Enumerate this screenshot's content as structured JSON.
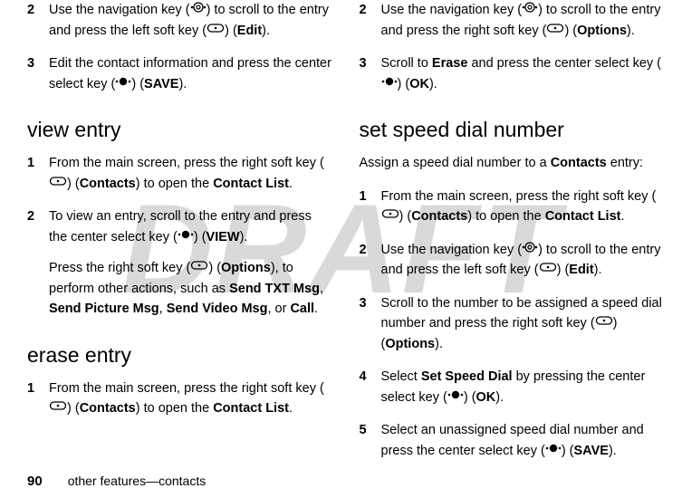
{
  "watermark": "DRAFT",
  "left": {
    "steps_a": [
      {
        "num": "2",
        "body": "Use the navigation key (NAV) to scroll to the entry and press the left soft key (LSOFT) (<b>Edit</b>)."
      },
      {
        "num": "3",
        "body": "Edit the contact information and press the center select key (CENTER) (<b>SAVE</b>)."
      }
    ],
    "section_view": "view entry",
    "steps_view": [
      {
        "num": "1",
        "body": "From the main screen, press the right soft key (RSOFT) (<b>Contacts</b>) to open the <b>Contact List</b>."
      },
      {
        "num": "2",
        "body": "To view an entry, scroll to the entry and press the center select key (CENTER) (<b>VIEW</b>).",
        "extra": "Press the right soft key (RSOFT) (<b>Options</b>), to perform other actions, such as <b>Send TXT Msg</b>, <b>Send Picture Msg</b>, <b>Send Video Msg</b>, or <b>Call</b>."
      }
    ],
    "section_erase": "erase entry",
    "steps_erase": [
      {
        "num": "1",
        "body": "From the main screen, press the right soft key (RSOFT) (<b>Contacts</b>) to open the <b>Contact List</b>."
      }
    ]
  },
  "right": {
    "steps_a": [
      {
        "num": "2",
        "body": "Use the navigation key (NAV) to scroll to the entry and press the right soft key (RSOFT) (<b>Options</b>)."
      },
      {
        "num": "3",
        "body": "Scroll to <b>Erase</b> and press the center select key (CENTER) (<b>OK</b>)."
      }
    ],
    "section_speed": "set speed dial number",
    "intro": "Assign a speed dial number to a <b>Contacts</b> entry:",
    "steps_speed": [
      {
        "num": "1",
        "body": "From the main screen, press the right soft key (RSOFT) (<b>Contacts</b>) to open the <b>Contact List</b>."
      },
      {
        "num": "2",
        "body": "Use the navigation key (NAV) to scroll to the entry and press the left soft key (LSOFT) (<b>Edit</b>)."
      },
      {
        "num": "3",
        "body": "Scroll to the number to be assigned a speed dial number and press the right soft key (RSOFT) (<b>Options</b>)."
      },
      {
        "num": "4",
        "body": "Select <b>Set Speed Dial</b> by pressing the center select key (CENTER) (<b>OK</b>)."
      },
      {
        "num": "5",
        "body": "Select an unassigned speed dial number and press the center select key (CENTER) (<b>SAVE</b>)."
      }
    ]
  },
  "footer": {
    "page": "90",
    "text": "other features—contacts"
  }
}
